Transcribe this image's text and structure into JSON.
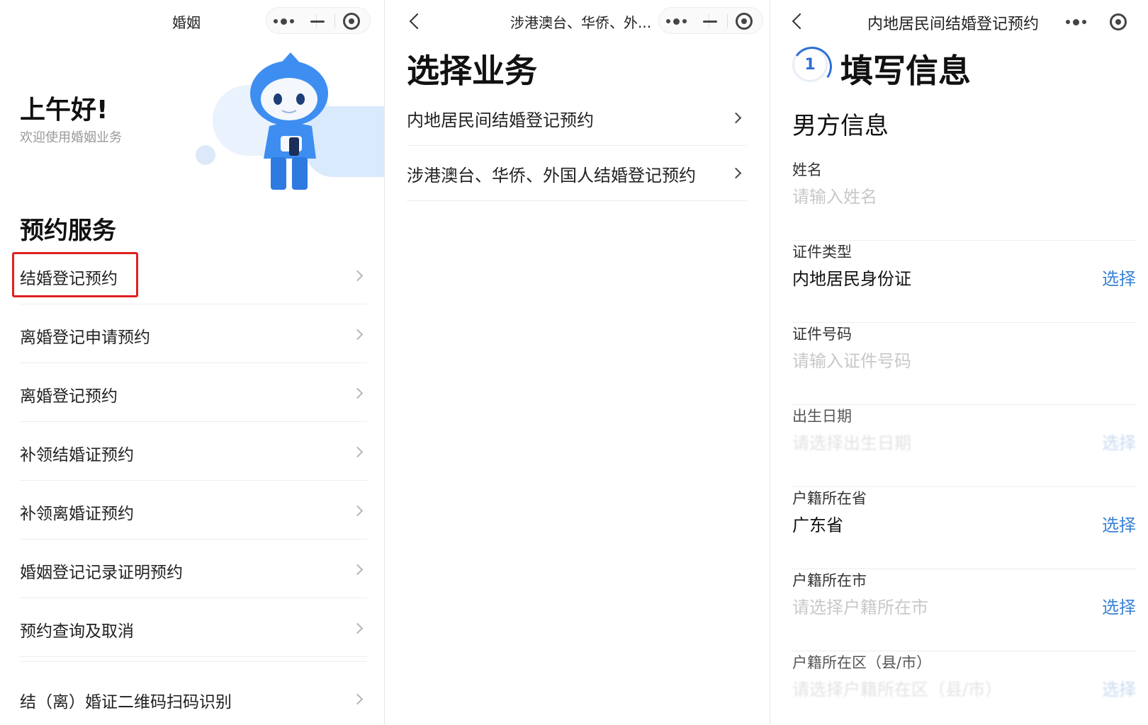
{
  "panel1": {
    "nav_title": "婚姻",
    "greeting": "上午好!",
    "greeting_sub": "欢迎使用婚姻业务",
    "section_title": "预约服务",
    "menu_items": [
      {
        "label": "结婚登记预约"
      },
      {
        "label": "离婚登记申请预约"
      },
      {
        "label": "离婚登记预约"
      },
      {
        "label": "补领结婚证预约"
      },
      {
        "label": "补领离婚证预约"
      },
      {
        "label": "婚姻登记记录证明预约"
      },
      {
        "label": "预约查询及取消"
      },
      {
        "label": "结（离）婚证二维码扫码识别"
      }
    ],
    "highlighted_item": "结婚登记预约"
  },
  "panel2": {
    "nav_title": "涉港澳台、华侨、外...",
    "page_title": "选择业务",
    "items": [
      {
        "label": "内地居民间结婚登记预约"
      },
      {
        "label": "涉港澳台、华侨、外国人结婚登记预约"
      }
    ]
  },
  "panel3": {
    "nav_title": "内地居民间结婚登记预约",
    "step_number": "1",
    "step_title": "填写信息",
    "section_title": "男方信息",
    "fields": [
      {
        "label": "姓名",
        "placeholder": "请输入姓名",
        "value": "",
        "action": ""
      },
      {
        "label": "证件类型",
        "placeholder": "",
        "value": "内地居民身份证",
        "action": "选择"
      },
      {
        "label": "证件号码",
        "placeholder": "请输入证件号码",
        "value": "",
        "action": ""
      },
      {
        "label": "出生日期",
        "placeholder": "请选择出生日期",
        "value": "",
        "action": "选择"
      },
      {
        "label": "户籍所在省",
        "placeholder": "",
        "value": "广东省",
        "action": "选择"
      },
      {
        "label": "户籍所在市",
        "placeholder": "请选择户籍所在市",
        "value": "",
        "action": "选择"
      },
      {
        "label": "户籍所在区（县/市）",
        "placeholder": "请选择户籍所在区（县/市）",
        "value": "",
        "action": "选择"
      }
    ]
  },
  "colors": {
    "accent_blue": "#3a82d6",
    "highlight_red": "#e02020",
    "mascot_blue": "#3d8ef0"
  },
  "icons": [
    "more-dots-icon",
    "minimize-icon",
    "close-target-icon",
    "back-arrow-icon",
    "chevron-right-icon",
    "mascot-illustration"
  ]
}
